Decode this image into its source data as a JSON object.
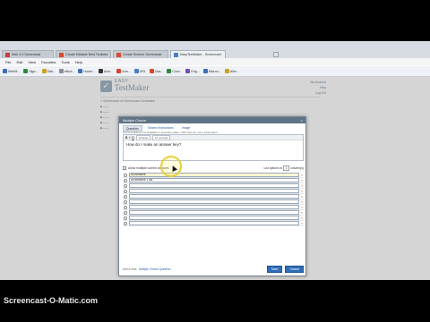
{
  "browser": {
    "tabs": [
      {
        "label": "Web 2.0 Screencast",
        "active": false
      },
      {
        "label": "Create Editable Best Toolbars",
        "active": false
      },
      {
        "label": "Create Screenr Screencast",
        "active": false
      },
      {
        "label": "EasyTestMaker - Screencast",
        "active": true
      }
    ],
    "menu": [
      "File",
      "Edit",
      "View",
      "Favorites",
      "Tools",
      "Help"
    ],
    "bookmarks": [
      "WebM...",
      "Sign...",
      "Stat...",
      "eBud...",
      "Home...",
      "Arch...",
      "Ann...",
      "URL",
      "Usa...",
      "Conv...",
      "Eng...",
      "Micron...",
      "vBer..."
    ]
  },
  "site": {
    "logo_line1": "EASY",
    "logo_line2": "TestMaker",
    "breadcrumb": "< Screencast of Screencast Generator",
    "top_links": [
      "My Account",
      "Help",
      "Log Out"
    ]
  },
  "modal": {
    "title": "Multiple Choice",
    "close": "×",
    "tabs": [
      "Question",
      "Shared Instructions",
      "Image"
    ],
    "hint": "Text formatting now available in Question editor. Click here for more information.",
    "toolbar": {
      "bold": "B",
      "italic": "I",
      "underline": "U",
      "font_select": "Verdana",
      "size_select": "12 (normal)"
    },
    "question_text": "How do I make an answer key?",
    "allow_multiple_label": "Allow multiple correct answers",
    "list_options_label": "List options in",
    "columns_value": "1",
    "columns_label": "column(s)",
    "answers": [
      "All Answers",
      "All Answers 1 sdf",
      "",
      "",
      "",
      "",
      "",
      "",
      "",
      ""
    ],
    "footer_prefix": "Add a new:",
    "footer_link": "Multiple Choice Question",
    "save_label": "Save",
    "cancel_label": "Cancel"
  },
  "watermark": "Screencast-O-Matic.com",
  "colors": {
    "modal_title_bg": "#5f7386",
    "button_blue": "#2f6db8",
    "delete_icon": "#d05a28",
    "highlight_ring": "#e6cf3a"
  },
  "icons": {
    "tab_favicon": "page-icon",
    "bookmark": "favicon-icon",
    "close": "close-icon",
    "delete": "delete-x-icon",
    "cursor": "mouse-pointer-icon"
  }
}
